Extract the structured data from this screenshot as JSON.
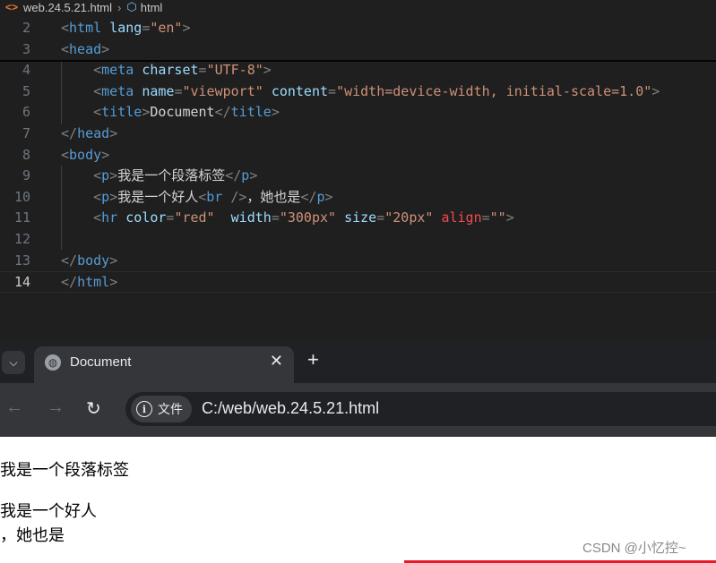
{
  "editor": {
    "breadcrumb": {
      "file": "web.24.5.21.html",
      "element": "html"
    },
    "lines": [
      {
        "num": "2",
        "tokens": [
          [
            "br",
            "<"
          ],
          [
            "tag",
            "html"
          ],
          [
            "txt",
            " "
          ],
          [
            "attr",
            "lang"
          ],
          [
            "br",
            "="
          ],
          [
            "str",
            "\"en\""
          ],
          [
            "br",
            ">"
          ]
        ]
      },
      {
        "num": "3",
        "tokens": [
          [
            "br",
            "<"
          ],
          [
            "tag",
            "head"
          ],
          [
            "br",
            ">"
          ]
        ]
      },
      {
        "num": "4",
        "tokens": [
          [
            "txt",
            "    "
          ],
          [
            "br",
            "<"
          ],
          [
            "tag",
            "meta"
          ],
          [
            "txt",
            " "
          ],
          [
            "attr",
            "charset"
          ],
          [
            "br",
            "="
          ],
          [
            "str",
            "\"UTF-8\""
          ],
          [
            "br",
            ">"
          ]
        ]
      },
      {
        "num": "5",
        "tokens": [
          [
            "txt",
            "    "
          ],
          [
            "br",
            "<"
          ],
          [
            "tag",
            "meta"
          ],
          [
            "txt",
            " "
          ],
          [
            "attr",
            "name"
          ],
          [
            "br",
            "="
          ],
          [
            "str",
            "\"viewport\""
          ],
          [
            "txt",
            " "
          ],
          [
            "attr",
            "content"
          ],
          [
            "br",
            "="
          ],
          [
            "str",
            "\"width=device-width, initial-scale=1.0\""
          ],
          [
            "br",
            ">"
          ]
        ]
      },
      {
        "num": "6",
        "tokens": [
          [
            "txt",
            "    "
          ],
          [
            "br",
            "<"
          ],
          [
            "tag",
            "title"
          ],
          [
            "br",
            ">"
          ],
          [
            "txt",
            "Document"
          ],
          [
            "br",
            "</"
          ],
          [
            "tag",
            "title"
          ],
          [
            "br",
            ">"
          ]
        ]
      },
      {
        "num": "7",
        "tokens": [
          [
            "br",
            "</"
          ],
          [
            "tag",
            "head"
          ],
          [
            "br",
            ">"
          ]
        ]
      },
      {
        "num": "8",
        "tokens": [
          [
            "br",
            "<"
          ],
          [
            "tag",
            "body"
          ],
          [
            "br",
            ">"
          ]
        ]
      },
      {
        "num": "9",
        "tokens": [
          [
            "txt",
            "    "
          ],
          [
            "br",
            "<"
          ],
          [
            "tag",
            "p"
          ],
          [
            "br",
            ">"
          ],
          [
            "txt",
            "我是一个段落标签"
          ],
          [
            "br",
            "</"
          ],
          [
            "tag",
            "p"
          ],
          [
            "br",
            ">"
          ]
        ]
      },
      {
        "num": "10",
        "tokens": [
          [
            "txt",
            "    "
          ],
          [
            "br",
            "<"
          ],
          [
            "tag",
            "p"
          ],
          [
            "br",
            ">"
          ],
          [
            "txt",
            "我是一个好人"
          ],
          [
            "br",
            "<"
          ],
          [
            "tag",
            "br"
          ],
          [
            "txt",
            " "
          ],
          [
            "br",
            "/>"
          ],
          [
            "txt",
            "，她也是"
          ],
          [
            "br",
            "</"
          ],
          [
            "tag",
            "p"
          ],
          [
            "br",
            ">"
          ]
        ]
      },
      {
        "num": "11",
        "tokens": [
          [
            "txt",
            "    "
          ],
          [
            "br",
            "<"
          ],
          [
            "tag",
            "hr"
          ],
          [
            "txt",
            " "
          ],
          [
            "attr",
            "color"
          ],
          [
            "br",
            "="
          ],
          [
            "str",
            "\"red\""
          ],
          [
            "txt",
            "  "
          ],
          [
            "attr",
            "width"
          ],
          [
            "br",
            "="
          ],
          [
            "str",
            "\"300px\""
          ],
          [
            "txt",
            " "
          ],
          [
            "attr",
            "size"
          ],
          [
            "br",
            "="
          ],
          [
            "str",
            "\"20px\""
          ],
          [
            "txt",
            " "
          ],
          [
            "err",
            "align"
          ],
          [
            "br",
            "="
          ],
          [
            "str",
            "\"\""
          ],
          [
            "br",
            ">"
          ]
        ]
      },
      {
        "num": "12",
        "tokens": []
      },
      {
        "num": "13",
        "tokens": [
          [
            "br",
            "</"
          ],
          [
            "tag",
            "body"
          ],
          [
            "br",
            ">"
          ]
        ]
      },
      {
        "num": "14",
        "tokens": [
          [
            "br",
            "</"
          ],
          [
            "tag",
            "html"
          ],
          [
            "br",
            ">"
          ]
        ],
        "active": true
      }
    ]
  },
  "browser": {
    "tab_title": "Document",
    "close_glyph": "✕",
    "new_tab_glyph": "+",
    "site_info_label": "文件",
    "url": "C:/web/web.24.5.21.html"
  },
  "page": {
    "para1": "我是一个段落标签",
    "para2_line1": "我是一个好人",
    "para2_line2": "，她也是",
    "hr_color": "#e8182a"
  },
  "watermark": "CSDN @小忆控~",
  "colors": {
    "editor_bg": "#1f1f1f",
    "tag": "#569cd6",
    "attr": "#9cdcfe",
    "string": "#ce9178",
    "bracket": "#808080",
    "error": "#f14c4c",
    "browser_frame": "#202124",
    "browser_toolbar": "#35363a"
  },
  "icons": {
    "breadcrumb_file": "html-file-icon",
    "breadcrumb_element": "cube-icon",
    "tab_search": "chevron-down-icon",
    "favicon": "globe-icon",
    "back": "arrow-left-icon",
    "forward": "arrow-right-icon",
    "reload": "reload-icon",
    "site_info": "info-icon"
  }
}
